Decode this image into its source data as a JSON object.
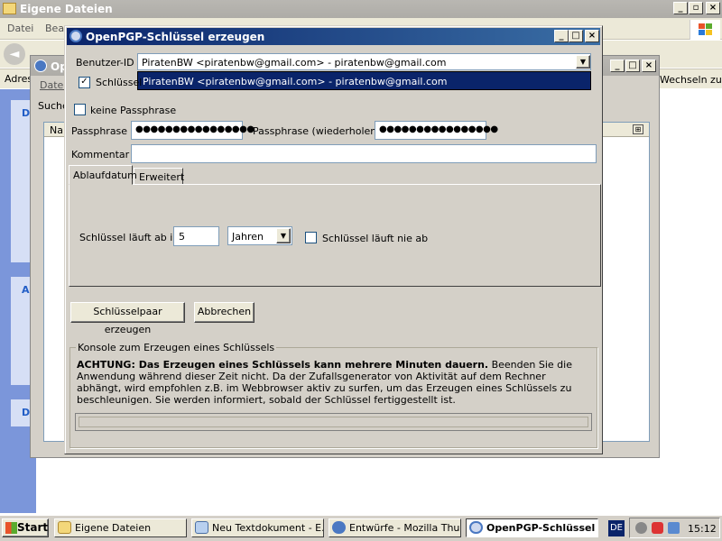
{
  "explorer": {
    "title": "Eigene Dateien",
    "menu": [
      "Datei",
      "Bea"
    ],
    "address_label": "Adres",
    "suche": "Suche",
    "nar": "Nar",
    "section_d1": "D",
    "section_a": "A",
    "section_d2": "D"
  },
  "thunderbird": {
    "title": "Op",
    "datei": "Datei",
    "wechseln": "Wechseln zu"
  },
  "dialog": {
    "title": "OpenPGP-Schlüssel erzeugen",
    "userid_label": "Benutzer-ID",
    "userid_value": "PiratenBW <piratenbw@gmail.com> - piratenbw@gmail.com",
    "dropdown_option": "PiratenBW <piratenbw@gmail.com> - piratenbw@gmail.com",
    "use_key_label": "Schlüssel",
    "no_passphrase_label": "keine Passphrase",
    "passphrase_label": "Passphrase",
    "passphrase_value": "●●●●●●●●●●●●●●●●",
    "passphrase_repeat_label": "Passphrase (wiederholen)",
    "passphrase_repeat_value": "●●●●●●●●●●●●●●●●",
    "comment_label": "Kommentar",
    "comment_value": "",
    "tabs": [
      "Ablaufdatum",
      "Erweitert"
    ],
    "expires_label": "Schlüssel läuft ab in",
    "expires_value": "5",
    "expires_unit": "Jahren",
    "never_expires_label": "Schlüssel läuft nie ab",
    "generate_button": "Schlüsselpaar erzeugen",
    "cancel_button": "Abbrechen",
    "console_legend": "Konsole zum Erzeugen eines Schlüssels",
    "console_bold": "ACHTUNG: Das Erzeugen eines Schlüssels kann mehrere Minuten dauern.",
    "console_text": " Beenden Sie die Anwendung während dieser Zeit nicht. Da der Zufallsgenerator von Aktivität auf dem Rechner abhängt, wird empfohlen z.B. im Webbrowser aktiv zu surfen, um das Erzeugen eines Schlüssels zu beschleunigen. Sie werden informiert, sobald der Schlüssel fertiggestellt ist."
  },
  "taskbar": {
    "start": "Start",
    "items": [
      "Eigene Dateien",
      "Neu Textdokument - E...",
      "Entwürfe - Mozilla Thu...",
      "OpenPGP-Schlüssel ..."
    ],
    "lang": "DE",
    "clock": "15:12"
  },
  "colors": {
    "title_active": "#0a246a",
    "title_inactive": "#aeaca7",
    "taskbar": "#d4d0c8",
    "dropdown_sel": "#0a246a"
  }
}
